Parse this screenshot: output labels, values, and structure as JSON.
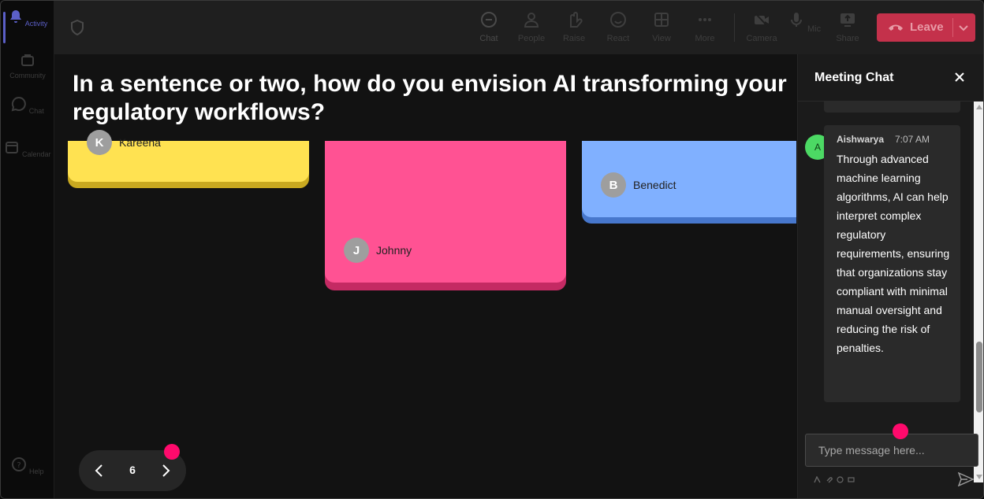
{
  "rail": {
    "items": [
      {
        "label": "Activity",
        "icon": "bell-icon",
        "active": true
      },
      {
        "label": "Community",
        "icon": "community-icon",
        "active": false
      },
      {
        "label": "Chat",
        "icon": "chat-icon",
        "active": false
      },
      {
        "label": "Calendar",
        "icon": "calendar-icon",
        "active": false
      }
    ],
    "help_label": "Help"
  },
  "toolbar": {
    "chat": "Chat",
    "people": "People",
    "raise": "Raise",
    "react": "React",
    "view": "View",
    "more": "More",
    "camera": "Camera",
    "mic": "Mic",
    "share": "Share",
    "leave": "Leave"
  },
  "stage": {
    "question": "In a sentence or two, how do you envision AI transforming your regulatory workflows?",
    "cards": [
      {
        "color": "#ffe251",
        "initial": "K",
        "author": "Kareena"
      },
      {
        "color": "#ff5293",
        "initial": "J",
        "author": "Johnny"
      },
      {
        "color": "#80b0ff",
        "initial": "B",
        "author": "Benedict"
      }
    ],
    "pager": {
      "page": "6"
    }
  },
  "chat": {
    "title": "Meeting Chat",
    "message": {
      "initial": "A",
      "sender": "Aishwarya",
      "time": "7:07 AM",
      "text": "Through advanced machine learning algorithms, AI can help interpret complex regulatory requirements, ensuring that organizations stay compliant with minimal manual oversight and reducing the risk of penalties."
    },
    "input_placeholder": "Type message here..."
  },
  "colors": {
    "accent": "#5b5fc7",
    "leave": "#c4314b",
    "highlight_dot": "#ff0a6c",
    "avatar_green": "#4cd964"
  }
}
